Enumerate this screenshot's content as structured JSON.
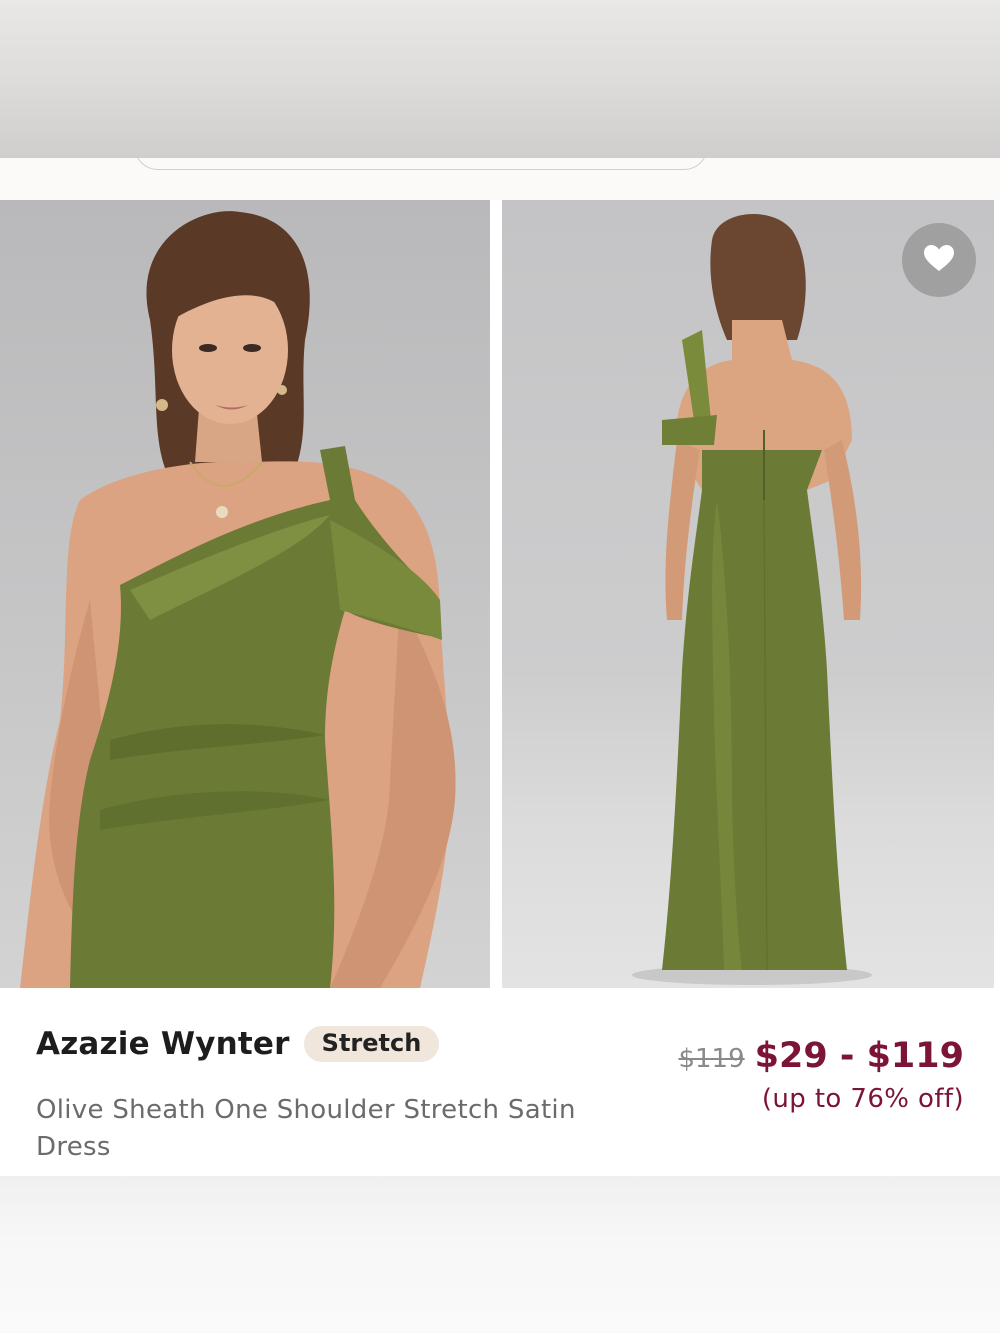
{
  "product": {
    "brand": "Azazie Wynter",
    "badge": "Stretch",
    "name": "Olive Sheath One Shoulder Stretch Satin Dress",
    "original_price": "$119",
    "price_range": "$29 - $119",
    "discount": "(up to 76% off)"
  },
  "images": [
    {
      "name": "front-view-photo",
      "dress_color": "#6b7a34"
    },
    {
      "name": "back-view-photo",
      "dress_color": "#6b7a34"
    }
  ],
  "icons": {
    "favorite": "heart-icon"
  },
  "colors": {
    "price": "#7b1436",
    "badge_bg": "#f1e6dc",
    "dress": "#6b7a34"
  }
}
